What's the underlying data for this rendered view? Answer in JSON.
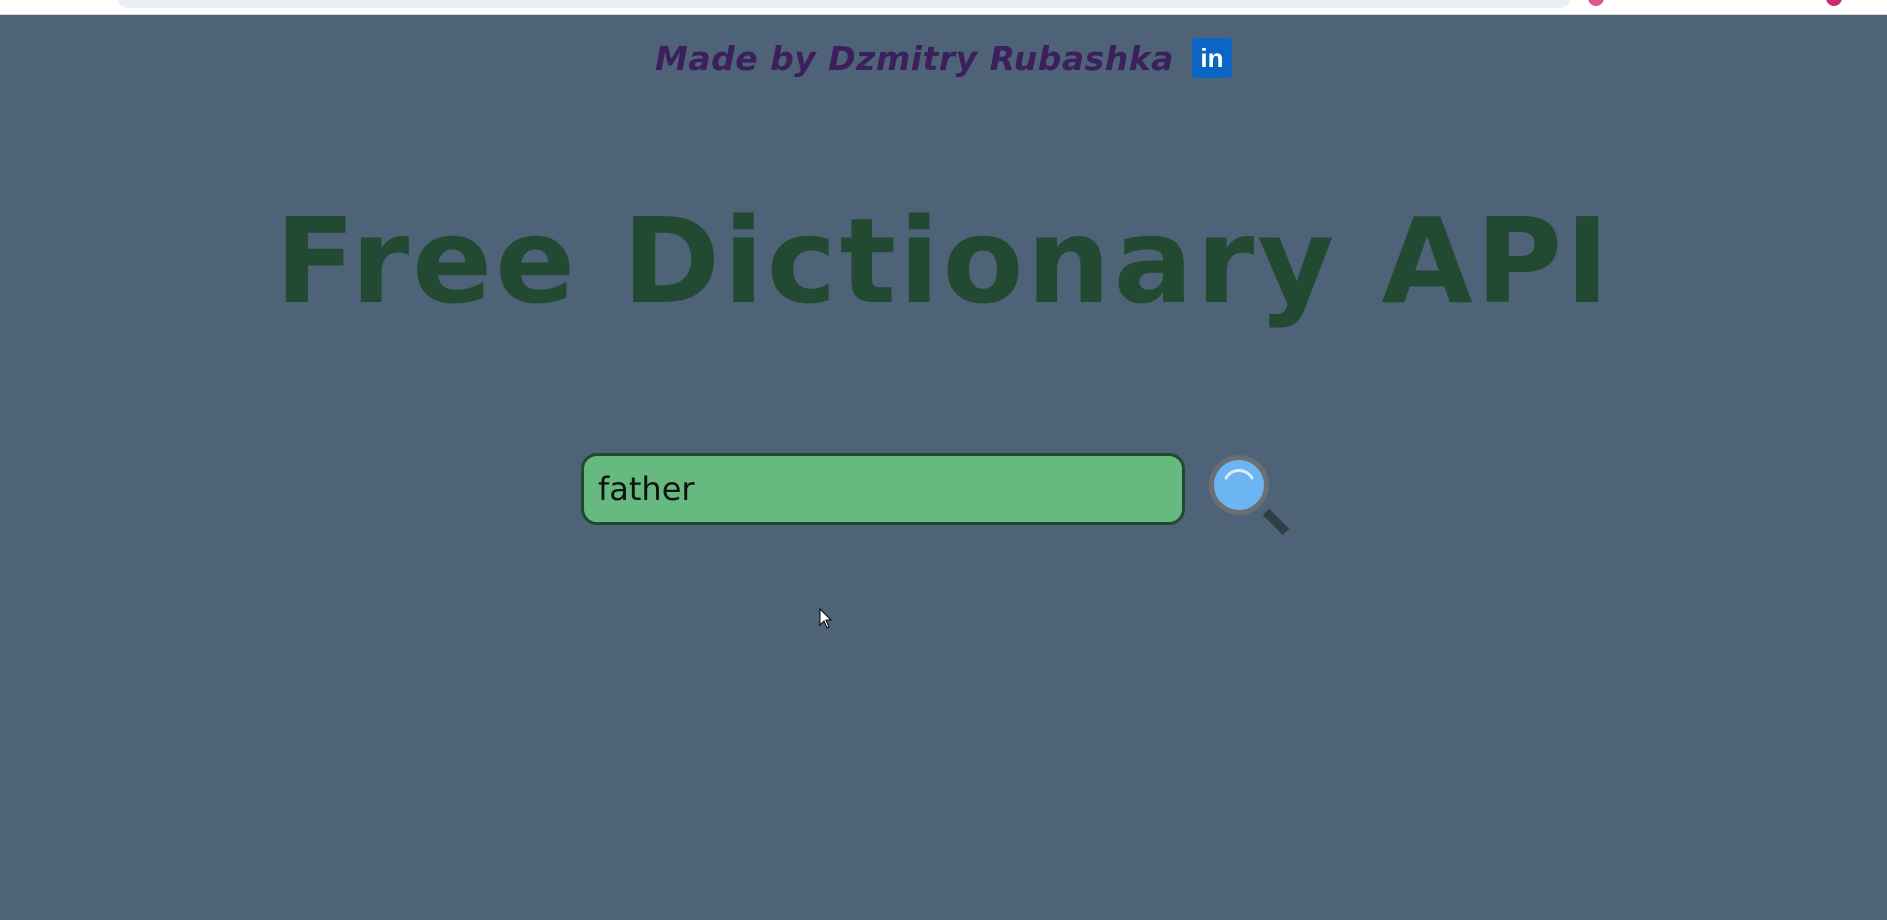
{
  "author": {
    "text": "Made by Dzmitry Rubashka",
    "linkedin_label": "in"
  },
  "title": "Free Dictionary API",
  "search": {
    "value": "father",
    "placeholder": ""
  },
  "icons": {
    "linkedin": "linkedin-icon",
    "search": "magnifier-icon",
    "cursor": "mouse-pointer-icon"
  },
  "colors": {
    "background": "#4e6377",
    "title": "#224a32",
    "author": "#3c1f5d",
    "input_fill": "#66ba80",
    "linkedin": "#0a66c2",
    "magnifier_lens": "#6cb4f2"
  }
}
